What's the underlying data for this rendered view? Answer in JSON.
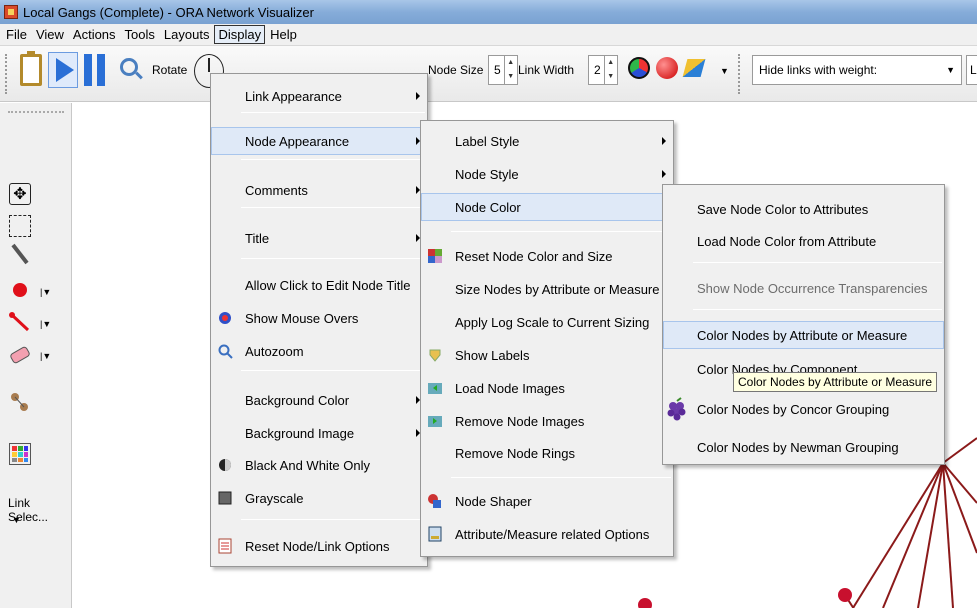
{
  "window": {
    "title": "Local Gangs (Complete) - ORA Network Visualizer"
  },
  "menubar": {
    "items": [
      "File",
      "View",
      "Actions",
      "Tools",
      "Layouts",
      "Display",
      "Help"
    ],
    "open": "Display"
  },
  "toolbar": {
    "rotate_label": "Rotate",
    "node_size_label": "Node Size",
    "node_size_value": "5",
    "link_width_label": "Link Width",
    "link_width_value": "2",
    "hide_links_label": "Hide links with weight:",
    "partial_combo_text": "L"
  },
  "palette": {
    "link_select_label": "Link Selec..."
  },
  "display_menu": [
    {
      "label": "Link Appearance",
      "submenu": true
    },
    {
      "label": "Node Appearance",
      "submenu": true,
      "highlighted": true
    },
    {
      "label": "Comments",
      "submenu": true
    },
    {
      "label": "Title",
      "submenu": true
    },
    {
      "label": "Allow Click to Edit Node Title"
    },
    {
      "label": "Show Mouse Overs",
      "icon": "mouse-over-icon"
    },
    {
      "label": "Autozoom",
      "icon": "autozoom-icon"
    },
    {
      "label": "Background Color",
      "submenu": true
    },
    {
      "label": "Background Image",
      "submenu": true
    },
    {
      "label": "Black And White Only",
      "icon": "black-white-icon"
    },
    {
      "label": "Grayscale",
      "icon": "grayscale-icon"
    },
    {
      "label": "Reset Node/Link Options",
      "icon": "reset-options-icon"
    }
  ],
  "node_menu": [
    {
      "label": "Label Style",
      "submenu": true
    },
    {
      "label": "Node Style",
      "submenu": true
    },
    {
      "label": "Node Color",
      "submenu": true,
      "highlighted": true
    },
    {
      "label": "Reset Node Color and Size",
      "icon": "reset-color-icon"
    },
    {
      "label": "Size Nodes by Attribute or Measure"
    },
    {
      "label": "Apply Log Scale to Current Sizing"
    },
    {
      "label": "Show Labels",
      "icon": "show-labels-icon"
    },
    {
      "label": "Load Node Images",
      "icon": "load-images-icon"
    },
    {
      "label": "Remove Node Images",
      "icon": "remove-images-icon"
    },
    {
      "label": "Remove Node Rings"
    },
    {
      "label": "Node Shaper",
      "icon": "node-shaper-icon"
    },
    {
      "label": "Attribute/Measure related Options",
      "icon": "attribute-options-icon"
    }
  ],
  "color_menu": [
    {
      "label": "Save Node Color to Attributes"
    },
    {
      "label": "Load Node Color from Attribute"
    },
    {
      "label": "Show Node Occurrence Transparencies",
      "disabled": true
    },
    {
      "label": "Color Nodes by Attribute or Measure",
      "highlighted": true
    },
    {
      "label": "Color Nodes by Component"
    },
    {
      "label": "Color Nodes by Concor Grouping",
      "icon": "grapes-icon"
    },
    {
      "label": "Color Nodes by Newman Grouping"
    }
  ],
  "tooltip": "Color Nodes by Attribute or Measure",
  "colors": {
    "node": "#c8102e",
    "link": "#8b1a1a",
    "highlight": "#dfe9f7",
    "title_bar": "#86acd9"
  }
}
